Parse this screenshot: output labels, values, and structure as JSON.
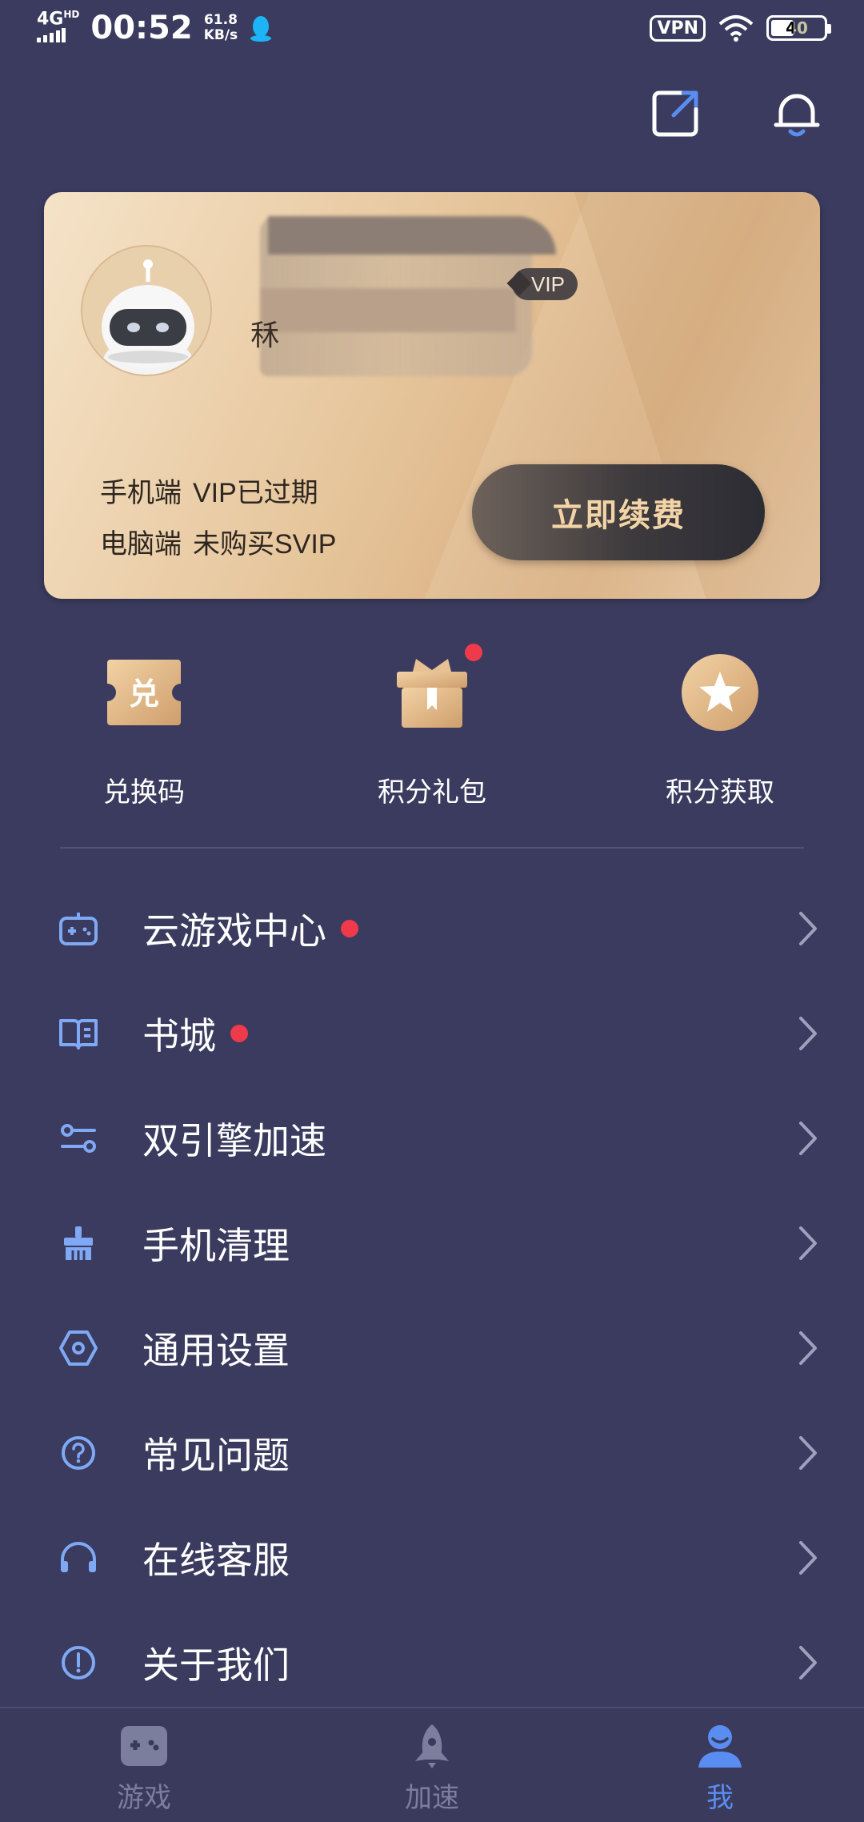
{
  "status_bar": {
    "network": "4G",
    "network_sup": "HD",
    "time": "00:52",
    "speed_value": "61.8",
    "speed_unit": "KB/s",
    "vpn": "VPN",
    "battery": "40"
  },
  "top_actions": {
    "share_icon": "share-external-icon",
    "bell_icon": "notification-bell-icon"
  },
  "vip_card": {
    "name_visible_char": "秝",
    "vip_badge": "VIP",
    "mobile_label": "手机端",
    "mobile_status": "VIP已过期",
    "pc_label": "电脑端",
    "pc_status": "未购买SVIP",
    "renew_button": "立即续费"
  },
  "quick_actions": [
    {
      "label": "兑换码",
      "icon": "redeem-ticket-icon",
      "badge": false
    },
    {
      "label": "积分礼包",
      "icon": "gift-box-icon",
      "badge": true
    },
    {
      "label": "积分获取",
      "icon": "star-coin-icon",
      "badge": false
    }
  ],
  "menu": [
    {
      "label": "云游戏中心",
      "icon": "gamepad-icon",
      "dot": true
    },
    {
      "label": "书城",
      "icon": "book-icon",
      "dot": true
    },
    {
      "label": "双引擎加速",
      "icon": "dual-engine-icon",
      "dot": false
    },
    {
      "label": "手机清理",
      "icon": "broom-icon",
      "dot": false
    },
    {
      "label": "通用设置",
      "icon": "settings-hexagon-icon",
      "dot": false
    },
    {
      "label": "常见问题",
      "icon": "question-icon",
      "dot": false
    },
    {
      "label": "在线客服",
      "icon": "headset-icon",
      "dot": false
    },
    {
      "label": "关于我们",
      "icon": "info-icon",
      "dot": false
    }
  ],
  "bottom_nav": [
    {
      "label": "游戏",
      "icon": "game-controller-icon",
      "active": false
    },
    {
      "label": "加速",
      "icon": "rocket-icon",
      "active": false
    },
    {
      "label": "我",
      "icon": "person-icon",
      "active": true
    }
  ],
  "colors": {
    "background": "#3a3b5e",
    "accent_blue": "#5a8df2",
    "icon_blue": "#7fa9f5",
    "red_dot": "#ee3a4a",
    "gold": "#e6c59b"
  }
}
